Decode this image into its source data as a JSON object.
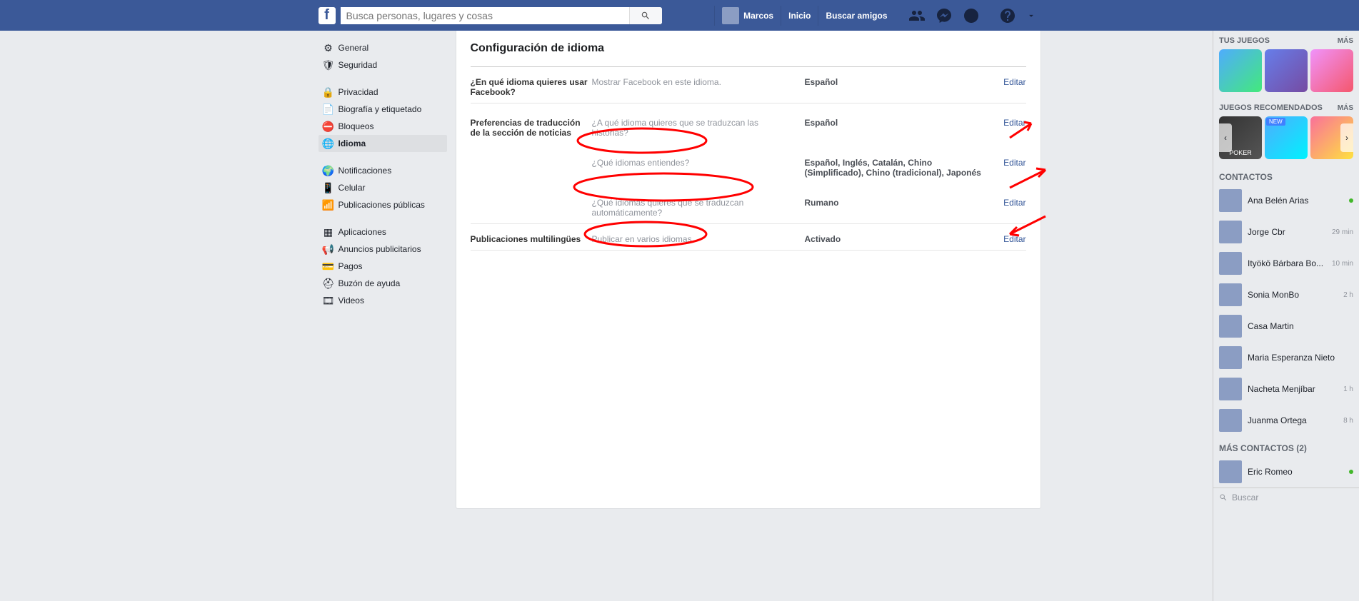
{
  "topbar": {
    "search_placeholder": "Busca personas, lugares y cosas",
    "profile_name": "Marcos",
    "home": "Inicio",
    "find_friends": "Buscar amigos"
  },
  "sidebar": {
    "group1": [
      {
        "icon": "⚙",
        "label": "General"
      },
      {
        "icon": "🛡",
        "label": "Seguridad"
      }
    ],
    "group2": [
      {
        "icon": "🔒",
        "label": "Privacidad"
      },
      {
        "icon": "📄",
        "label": "Biografía y etiquetado"
      },
      {
        "icon": "⛔",
        "label": "Bloqueos"
      },
      {
        "icon": "🌐",
        "label": "Idioma",
        "active": true
      }
    ],
    "group3": [
      {
        "icon": "🌍",
        "label": "Notificaciones"
      },
      {
        "icon": "📱",
        "label": "Celular"
      },
      {
        "icon": "📶",
        "label": "Publicaciones públicas"
      }
    ],
    "group4": [
      {
        "icon": "▦",
        "label": "Aplicaciones"
      },
      {
        "icon": "📢",
        "label": "Anuncios publicitarios"
      },
      {
        "icon": "💳",
        "label": "Pagos"
      },
      {
        "icon": "⛑",
        "label": "Buzón de ayuda"
      },
      {
        "icon": "🎞",
        "label": "Videos"
      }
    ]
  },
  "content": {
    "title": "Configuración de idioma",
    "rows": [
      {
        "label": "¿En qué idioma quieres usar Facebook?",
        "desc": "Mostrar Facebook en este idioma.",
        "value": "Español",
        "edit": "Editar"
      },
      {
        "label": "Preferencias de traducción de la sección de noticias",
        "desc": "¿A qué idioma quieres que se traduzcan las historias?",
        "value": "Español",
        "edit": "Editar"
      },
      {
        "label": "",
        "desc": "¿Qué idiomas entiendes?",
        "value": "Español, Inglés, Catalán, Chino (Simplificado), Chino (tradicional), Japonés",
        "edit": "Editar"
      },
      {
        "label": "",
        "desc": "¿Qué idiomas quieres que se traduzcan automáticamente?",
        "value": "Rumano",
        "edit": "Editar"
      },
      {
        "label": "Publicaciones multilingües",
        "desc": "Publicar en varios idiomas",
        "value": "Activado",
        "edit": "Editar"
      }
    ]
  },
  "rightcol": {
    "your_games": "TUS JUEGOS",
    "rec_games": "JUEGOS RECOMENDADOS",
    "more": "MÁS",
    "new_badge": "NEW",
    "contacts_header": "CONTACTOS",
    "contacts": [
      {
        "name": "Ana Belén Arias",
        "status_type": "online"
      },
      {
        "name": "Jorge Cbr",
        "status": "29 min"
      },
      {
        "name": "Ityökö Bárbara Bo...",
        "status": "10 min"
      },
      {
        "name": "Sonia MonBo",
        "status": "2 h"
      },
      {
        "name": "Casa Martin",
        "status": ""
      },
      {
        "name": "Maria Esperanza Nieto",
        "status": ""
      },
      {
        "name": "Nacheta Menjíbar",
        "status": "1 h"
      },
      {
        "name": "Juanma Ortega",
        "status": "8 h"
      }
    ],
    "more_contacts": "MÁS CONTACTOS (2)",
    "more_contacts_list": [
      {
        "name": "Eric Romeo",
        "status_type": "online"
      }
    ],
    "search_placeholder": "Buscar"
  }
}
